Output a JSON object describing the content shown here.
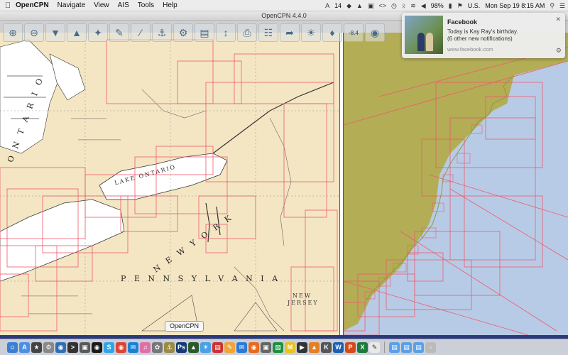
{
  "menubar": {
    "app_name": "OpenCPN",
    "menus": [
      "Navigate",
      "View",
      "AIS",
      "Tools",
      "Help"
    ],
    "status_text_1": "14",
    "battery": "98%",
    "input_source": "U.S.",
    "clock": "Mon Sep 19  8:15 AM"
  },
  "window": {
    "title": "OpenCPN 4.4.0"
  },
  "toolbar": {
    "scale_text": "-8.4"
  },
  "map_left": {
    "labels": {
      "lake_ontario": "LAKE ONTARIO",
      "ontario": "O N T A R I O",
      "new_york": "N E W  Y O R K",
      "pennsylvania": "P E N N S Y L V A N I A",
      "new_jersey_1": "NEW",
      "new_jersey_2": "JERSEY"
    }
  },
  "notification": {
    "title": "Facebook",
    "line1": "Today is Kay Ray's birthday.",
    "line2": "(6 other new notifications)",
    "url": "www.facebook.com"
  },
  "tooltip": {
    "text": "OpenCPN"
  },
  "colors": {
    "land_chart": "#f4e6c3",
    "water_chart": "#ffffff",
    "land_overview": "#b3ad55",
    "water_overview": "#b8cbe6",
    "chart_outline": "#ee5a6e"
  }
}
